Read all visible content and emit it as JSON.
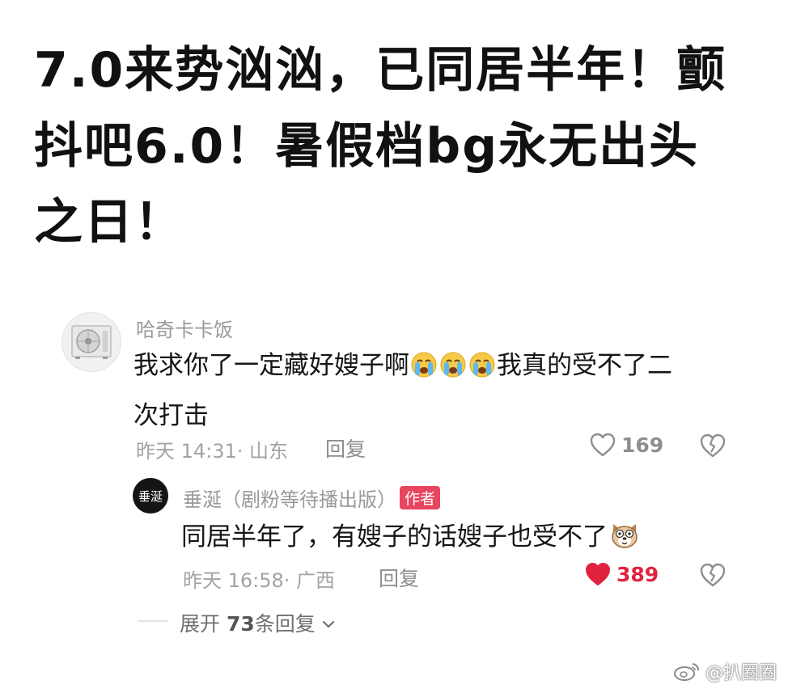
{
  "headline": {
    "line1": "7.0来势汹汹，已同居半年！颤",
    "line2": "抖吧6.0！暑假档bg永无出头",
    "line3": "之日！"
  },
  "comment": {
    "username": "哈奇卡卡饭",
    "text_part1": "我求你了一定藏好嫂子啊",
    "emojis": [
      "crying-face",
      "crying-face",
      "crying-face"
    ],
    "text_part2": "我真的受不了二",
    "text_line2": "次打击",
    "time": "昨天 14:31",
    "location": "· 山东",
    "reply_label": "回复",
    "likes": "169"
  },
  "reply": {
    "avatar_text": "垂涎",
    "username": "垂涎（剧粉等待播出版）",
    "badge": "作者",
    "text": "同居半年了，有嫂子的话嫂子也受不了",
    "emoji": "dog-face",
    "time": "昨天 16:58",
    "location": "· 广西",
    "reply_label": "回复",
    "likes": "389",
    "liked_color": "#e0223f"
  },
  "expand": {
    "prefix": "展开",
    "count": "73",
    "suffix": "条回复"
  },
  "watermark": {
    "text": "@扒圈圈"
  }
}
